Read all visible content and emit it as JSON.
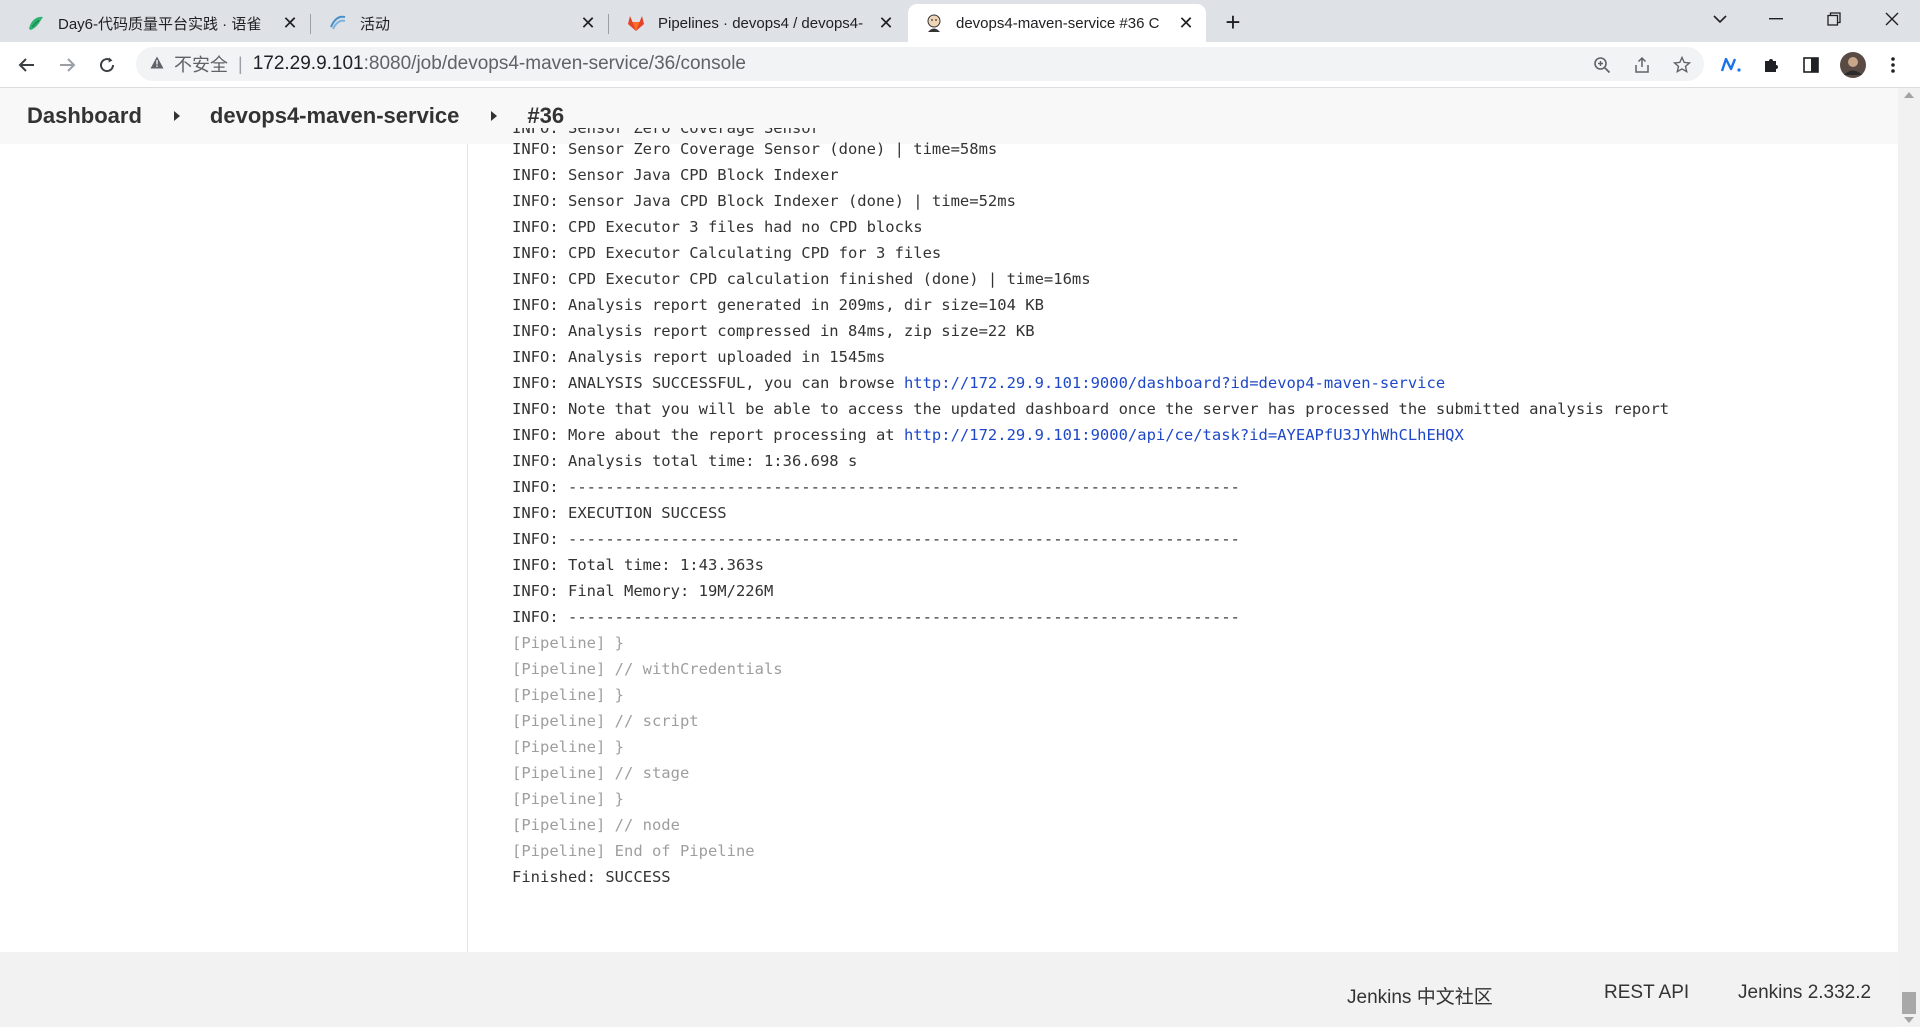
{
  "browser": {
    "tabs": [
      {
        "title": "Day6-代码质量平台实践 · 语雀",
        "icon": "yuque-logo-icon"
      },
      {
        "title": "活动",
        "icon": "wave-logo-icon"
      },
      {
        "title": "Pipelines · devops4 / devops4-",
        "icon": "gitlab-logo-icon"
      },
      {
        "title": "devops4-maven-service #36 C",
        "icon": "jenkins-logo-icon",
        "active": true
      }
    ],
    "close_glyph": "✕",
    "new_tab_glyph": "+",
    "address": {
      "security_label": "不安全",
      "host": "172.29.9.101",
      "path": ":8080/job/devops4-maven-service/36/console"
    }
  },
  "breadcrumbs": [
    {
      "label": "Dashboard"
    },
    {
      "label": "devops4-maven-service"
    },
    {
      "label": "#36"
    }
  ],
  "console": {
    "partial_top_line": "INFO: Sensor Zero Coverage Sensor",
    "lines": [
      {
        "text": "INFO: Sensor Zero Coverage Sensor (done) | time=58ms"
      },
      {
        "text": "INFO: Sensor Java CPD Block Indexer"
      },
      {
        "text": "INFO: Sensor Java CPD Block Indexer (done) | time=52ms"
      },
      {
        "text": "INFO: CPD Executor 3 files had no CPD blocks"
      },
      {
        "text": "INFO: CPD Executor Calculating CPD for 3 files"
      },
      {
        "text": "INFO: CPD Executor CPD calculation finished (done) | time=16ms"
      },
      {
        "text": "INFO: Analysis report generated in 209ms, dir size=104 KB"
      },
      {
        "text": "INFO: Analysis report compressed in 84ms, zip size=22 KB"
      },
      {
        "text": "INFO: Analysis report uploaded in 1545ms"
      },
      {
        "text": "INFO: ANALYSIS SUCCESSFUL, you can browse ",
        "link": "http://172.29.9.101:9000/dashboard?id=devop4-maven-service"
      },
      {
        "text": "INFO: Note that you will be able to access the updated dashboard once the server has processed the submitted analysis report"
      },
      {
        "text": "INFO: More about the report processing at ",
        "link": "http://172.29.9.101:9000/api/ce/task?id=AYEAPfU3JYhWhCLhEHQX"
      },
      {
        "text": "INFO: Analysis total time: 1:36.698 s"
      },
      {
        "text": "INFO: ------------------------------------------------------------------------"
      },
      {
        "text": "INFO: EXECUTION SUCCESS"
      },
      {
        "text": "INFO: ------------------------------------------------------------------------"
      },
      {
        "text": "INFO: Total time: 1:43.363s"
      },
      {
        "text": "INFO: Final Memory: 19M/226M"
      },
      {
        "text": "INFO: ------------------------------------------------------------------------"
      },
      {
        "text": "[Pipeline] }",
        "pipeline": true
      },
      {
        "text": "[Pipeline] // withCredentials",
        "pipeline": true
      },
      {
        "text": "[Pipeline] }",
        "pipeline": true
      },
      {
        "text": "[Pipeline] // script",
        "pipeline": true
      },
      {
        "text": "[Pipeline] }",
        "pipeline": true
      },
      {
        "text": "[Pipeline] // stage",
        "pipeline": true
      },
      {
        "text": "[Pipeline] }",
        "pipeline": true
      },
      {
        "text": "[Pipeline] // node",
        "pipeline": true
      },
      {
        "text": "[Pipeline] End of Pipeline",
        "pipeline": true
      },
      {
        "text": "Finished: SUCCESS"
      }
    ]
  },
  "footer": {
    "community": "Jenkins 中文社区",
    "rest_api": "REST API",
    "version": "Jenkins 2.332.2"
  },
  "colors": {
    "link": "#1f48c8",
    "pipeline_text": "#9e9e9e",
    "console_text": "#333333"
  }
}
